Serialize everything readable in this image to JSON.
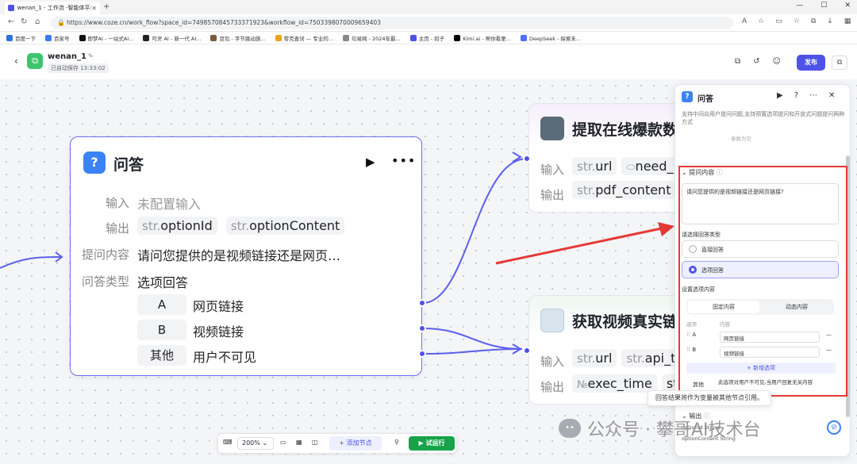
{
  "browser": {
    "tab_title": "wenan_1 - 工作流 -智能体平台",
    "new_tab": "+",
    "url": "https://www.coze.cn/work_flow?space_id=7498570845733371923&workflow_id=7503398070009659403",
    "bookmarks": [
      "百度一下",
      "百家号",
      "即梦AI - 一站式AI...",
      "可灵 AI - 新一代 AI...",
      "豆包 - 字节跳动旗...",
      "零克查词 — 专业的...",
      "句易网 - 2024年最...",
      "主页 - 扣子",
      "Kimi.ai - 帮你看更...",
      "DeepSeek - 探索未..."
    ]
  },
  "app": {
    "name": "wenan_1",
    "autosave": "已自动保存 13:33:02",
    "publish": "发布"
  },
  "node_main": {
    "title": "问答",
    "input_label": "输入",
    "input_value": "未配置输入",
    "output_label": "输出",
    "outputs": [
      {
        "type": "str.",
        "name": "optionId"
      },
      {
        "type": "str.",
        "name": "optionContent"
      }
    ],
    "question_label": "提问内容",
    "question_value": "请问您提供的是视频链接还是网页…",
    "answer_type_label": "问答类型",
    "answer_type_value": "选项回答",
    "options": [
      {
        "key": "A",
        "value": "网页链接"
      },
      {
        "key": "B",
        "value": "视频链接"
      },
      {
        "key": "其他",
        "value": "用户不可见"
      }
    ]
  },
  "node_a": {
    "title": "提取在线爆款数",
    "input_label": "输入",
    "input_chip1_type": "str.",
    "input_chip1": "url",
    "input_chip2": "need_i",
    "output_label": "输出",
    "output_chip_type": "str.",
    "output_chip": "pdf_content"
  },
  "node_b": {
    "title": "获取视频真实链",
    "input_label": "输入",
    "input_chip1_type": "str.",
    "input_chip1": "url",
    "input_chip2_type": "str.",
    "input_chip2": "api_tol",
    "output_label": "输出",
    "output_chip1_type": "№",
    "output_chip1": "exec_time",
    "output_chip2": "str"
  },
  "tooltip": "回答结果将作为变量被其他节点引用。",
  "toolbar": {
    "zoom": "200%",
    "add_node": "+ 添加节点",
    "test_run": "试运行"
  },
  "panel": {
    "title": "问答",
    "desc": "支持中间向用户提问问题,支持预置选项提问和开放式问题提问两种方式",
    "empty_hint": "参数为空",
    "question_section": "提问内容",
    "question_text": "请问您提供的是视频链接还是网页链接?",
    "answer_type_section": "请选择回答类型",
    "radio_direct": "直接回答",
    "radio_option": "选项回答",
    "options_section": "设置选项内容",
    "seg_fixed": "固定内容",
    "seg_dynamic": "动态内容",
    "col_option": "选项",
    "col_content": "内容",
    "options": [
      {
        "key": "A",
        "value": "网页链接"
      },
      {
        "key": "B",
        "value": "视频链接"
      }
    ],
    "add_option": "+ 新增选项",
    "other_label": "其他",
    "other_note": "此选项对用户不可见,当用户回复无关内容",
    "output_section": "输出",
    "output1": "optionId String",
    "output2": "optionContent String"
  },
  "watermark": "公众号 · 攀哥AI技术台",
  "colors": {
    "accent": "#4d53e8",
    "highlight": "#e53935",
    "run": "#17a34a"
  }
}
